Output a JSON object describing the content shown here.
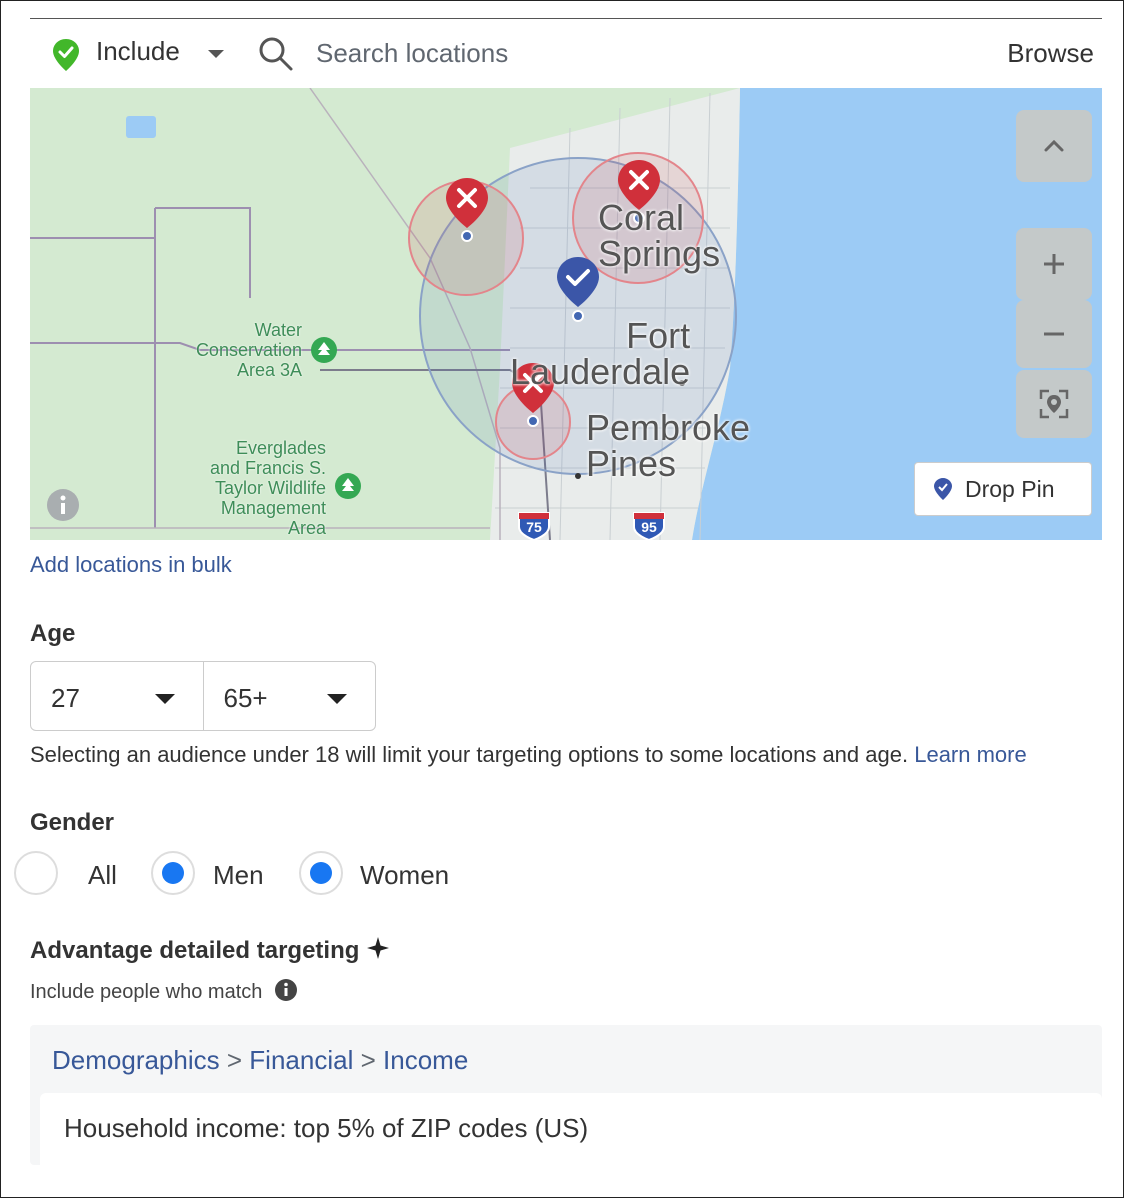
{
  "toolbar": {
    "include_label": "Include",
    "search_placeholder": "Search locations",
    "browse_label": "Browse"
  },
  "map": {
    "labels": {
      "coral_springs_1": "Coral",
      "coral_springs_2": "Springs",
      "fort_lauderdale_1": "Fort",
      "fort_lauderdale_2": "Lauderdale",
      "pembroke_pines_1": "Pembroke",
      "pembroke_pines_2": "Pines",
      "water_conservation": [
        "Water",
        "Conservation",
        "Area 3A"
      ],
      "everglades": [
        "Everglades",
        "and Francis S.",
        "Taylor Wildlife",
        "Management",
        "Area"
      ],
      "shield_75": "75",
      "shield_95": "95"
    },
    "drop_pin_label": "Drop Pin",
    "colors": {
      "include_pin": "#4267b2",
      "exclude_pin": "#d0303b",
      "water": "#9ccbf5",
      "land": "#d4ead1"
    }
  },
  "bulk_link": "Add locations in bulk",
  "age": {
    "title": "Age",
    "min": "27",
    "max": "65+"
  },
  "notice": {
    "text": "Selecting an audience under 18 will limit your targeting options to some locations and age.",
    "link": "Learn more"
  },
  "gender": {
    "title": "Gender",
    "options": [
      {
        "label": "All",
        "selected": false
      },
      {
        "label": "Men",
        "selected": true
      },
      {
        "label": "Women",
        "selected": true
      }
    ]
  },
  "advantage": {
    "title": "Advantage detailed targeting",
    "subtitle": "Include people who match"
  },
  "targeting": {
    "crumbs": [
      "Demographics",
      "Financial",
      "Income"
    ],
    "separator": ">",
    "item": "Household income: top 5% of ZIP codes (US)"
  }
}
